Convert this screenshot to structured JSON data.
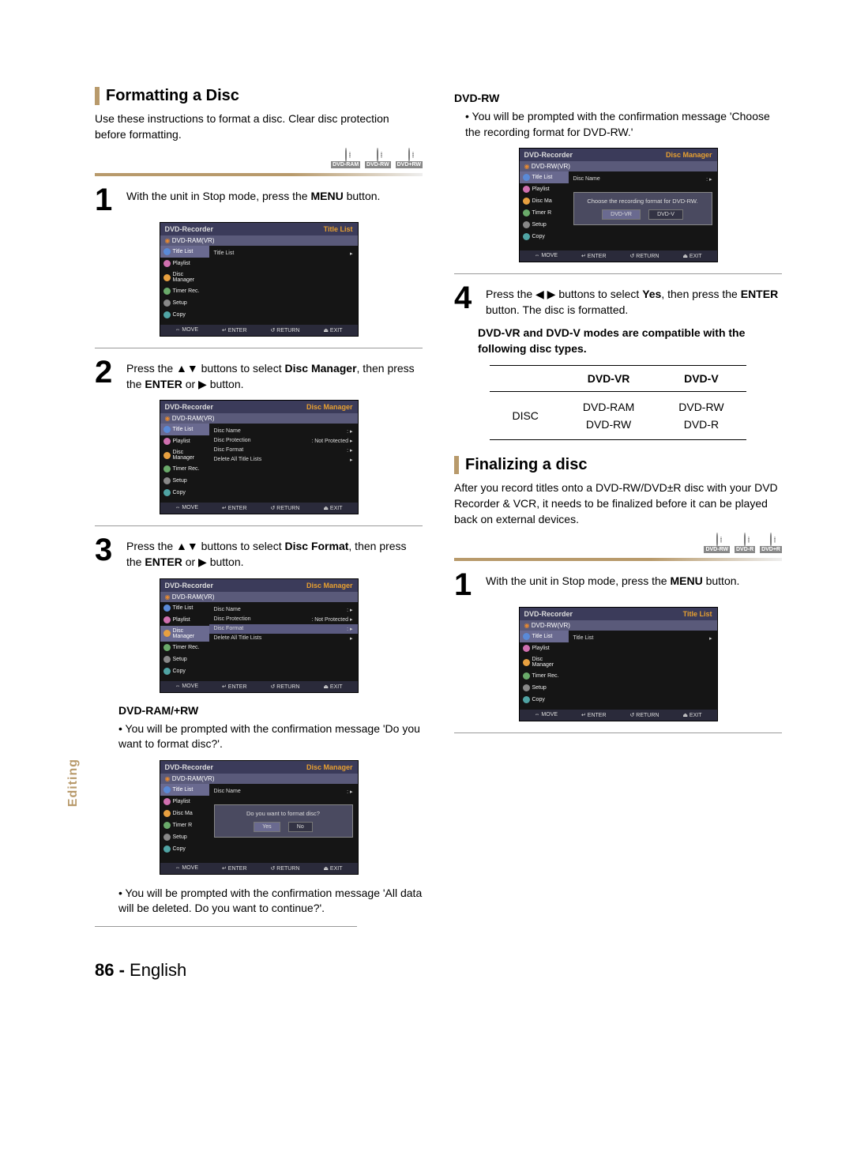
{
  "sideTab": "Editing",
  "left": {
    "h1": "Formatting a Disc",
    "intro": "Use these instructions to format a disc. Clear disc protection before formatting.",
    "badges": [
      "DVD-RAM",
      "DVD-RW",
      "DVD+RW"
    ],
    "step1": {
      "num": "1",
      "pre": "With the unit in Stop mode, press the ",
      "bold": "MENU",
      "post": " button."
    },
    "screen1": {
      "hdrL": "DVD-Recorder",
      "hdrR": "Title List",
      "sub": "DVD-RAM(VR)",
      "side": [
        "Title List",
        "Playlist",
        "Disc Manager",
        "Timer Rec.",
        "Setup",
        "Copy"
      ],
      "hlIndex": 0,
      "rows": [
        {
          "l": "Title List",
          "r": "",
          "arrow": true
        }
      ],
      "foot": [
        "⇔ MOVE",
        "↵ ENTER",
        "↺ RETURN",
        "⏏ EXIT"
      ]
    },
    "step2": {
      "num": "2",
      "pre": "Press the ▲▼ buttons to select ",
      "bold": "Disc Manager",
      "post": ", then press the ",
      "bold2": "ENTER",
      "post2": " or ▶ button."
    },
    "screen2": {
      "hdrL": "DVD-Recorder",
      "hdrR": "Disc Manager",
      "sub": "DVD-RAM(VR)",
      "side": [
        "Title List",
        "Playlist",
        "Disc Manager",
        "Timer Rec.",
        "Setup",
        "Copy"
      ],
      "hlIndex": 0,
      "rows": [
        {
          "l": "Disc Name",
          "r": ":",
          "arrow": true
        },
        {
          "l": "Disc Protection",
          "r": ": Not Protected",
          "arrow": true
        },
        {
          "l": "Disc Format",
          "r": ":",
          "arrow": true
        },
        {
          "l": "Delete All Title Lists",
          "r": "",
          "arrow": true
        }
      ],
      "foot": [
        "⇔ MOVE",
        "↵ ENTER",
        "↺ RETURN",
        "⏏ EXIT"
      ]
    },
    "step3": {
      "num": "3",
      "pre": "Press the ▲▼ buttons to select ",
      "bold": "Disc Format",
      "post": ", then press the ",
      "bold2": "ENTER",
      "post2": " or ▶ button."
    },
    "screen3": {
      "hdrL": "DVD-Recorder",
      "hdrR": "Disc Manager",
      "sub": "DVD-RAM(VR)",
      "side": [
        "Title List",
        "Playlist",
        "Disc Manager",
        "Timer Rec.",
        "Setup",
        "Copy"
      ],
      "hlIndex": 2,
      "rowHl": 2,
      "rows": [
        {
          "l": "Disc Name",
          "r": ":",
          "arrow": true
        },
        {
          "l": "Disc Protection",
          "r": ": Not Protected",
          "arrow": true
        },
        {
          "l": "Disc Format",
          "r": ":",
          "arrow": true
        },
        {
          "l": "Delete All Title Lists",
          "r": "",
          "arrow": true
        }
      ],
      "foot": [
        "⇔ MOVE",
        "↵ ENTER",
        "↺ RETURN",
        "⏏ EXIT"
      ]
    },
    "sub1": "DVD-RAM/+RW",
    "bullet1": "You will be prompted with the confirmation message 'Do you want to format disc?'.",
    "screen4": {
      "hdrL": "DVD-Recorder",
      "hdrR": "Disc Manager",
      "sub": "DVD-RAM(VR)",
      "side": [
        "Title List",
        "Playlist",
        "Disc Ma",
        "Timer R",
        "Setup",
        "Copy"
      ],
      "hlIndex": 0,
      "rows": [
        {
          "l": "Disc Name",
          "r": ":",
          "arrow": true
        }
      ],
      "dialog": {
        "msg": "Do you want to format disc?",
        "btns": [
          "Yes",
          "No"
        ],
        "hl": 0
      },
      "foot": [
        "⇔ MOVE",
        "↵ ENTER",
        "↺ RETURN",
        "⏏ EXIT"
      ]
    },
    "bullet2": "You will be prompted with the confirmation message 'All data will be deleted. Do you want to continue?'."
  },
  "right": {
    "sub1": "DVD-RW",
    "bullet1": "You will be prompted with the confirmation message 'Choose the recording format for DVD-RW.'",
    "screen1": {
      "hdrL": "DVD-Recorder",
      "hdrR": "Disc Manager",
      "sub": "DVD-RW(VR)",
      "side": [
        "Title List",
        "Playlist",
        "Disc Ma",
        "Timer R",
        "Setup",
        "Copy"
      ],
      "hlIndex": 0,
      "rows": [
        {
          "l": "Disc Name",
          "r": ":",
          "arrow": true
        }
      ],
      "dialog": {
        "msg": "Choose the recording format for DVD-RW.",
        "btns": [
          "DVD-VR",
          "DVD-V"
        ],
        "hl": 0
      },
      "foot": [
        "⇔ MOVE",
        "↵ ENTER",
        "↺ RETURN",
        "⏏ EXIT"
      ]
    },
    "step4": {
      "num": "4",
      "pre": "Press the ◀ ▶ buttons to select ",
      "bold": "Yes",
      "post": ", then press the ",
      "bold2": "ENTER",
      "post2": " button. The disc is formatted."
    },
    "boldNote": "DVD-VR and DVD-V modes are compatible with the following disc types.",
    "table": {
      "h1": "DVD-VR",
      "h2": "DVD-V",
      "rowLabel": "DISC",
      "c1a": "DVD-RAM",
      "c1b": "DVD-RW",
      "c2a": "DVD-RW",
      "c2b": "DVD-R"
    },
    "h2": "Finalizing a disc",
    "intro2": "After you record titles onto a DVD-RW/DVD±R disc with your DVD Recorder & VCR, it needs to be finalized before it can be played back on external devices.",
    "badges2": [
      "DVD-RW",
      "DVD-R",
      "DVD+R"
    ],
    "step1b": {
      "num": "1",
      "pre": "With the unit in Stop mode, press the ",
      "bold": "MENU",
      "post": " button."
    },
    "screen2b": {
      "hdrL": "DVD-Recorder",
      "hdrR": "Title List",
      "sub": "DVD-RW(VR)",
      "side": [
        "Title List",
        "Playlist",
        "Disc Manager",
        "Timer Rec.",
        "Setup",
        "Copy"
      ],
      "hlIndex": 0,
      "rows": [
        {
          "l": "Title List",
          "r": "",
          "arrow": true
        }
      ],
      "foot": [
        "⇔ MOVE",
        "↵ ENTER",
        "↺ RETURN",
        "⏏ EXIT"
      ]
    }
  },
  "foot": {
    "pn": "86 -",
    "lang": "English"
  }
}
